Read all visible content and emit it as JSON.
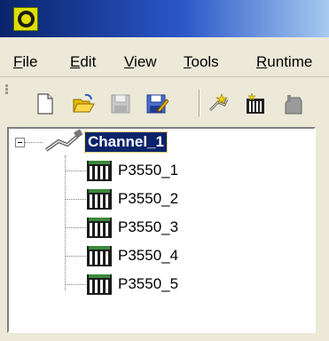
{
  "menubar": {
    "items": [
      {
        "accel": "F",
        "rest": "ile"
      },
      {
        "accel": "E",
        "rest": "dit"
      },
      {
        "accel": "V",
        "rest": "iew"
      },
      {
        "accel": "T",
        "rest": "ools"
      },
      {
        "accel": "R",
        "rest": "untime"
      }
    ]
  },
  "toolbar": {
    "buttons": [
      "new-document-icon",
      "open-folder-icon",
      "save-icon",
      "save-as-icon",
      "new-channel-icon",
      "new-device-icon",
      "properties-icon"
    ]
  },
  "tree": {
    "channel": {
      "label": "Channel_1",
      "expanded": true,
      "selected": true
    },
    "devices": [
      "P3550_1",
      "P3550_2",
      "P3550_3",
      "P3550_4",
      "P3550_5"
    ]
  },
  "colors": {
    "title_gradient_start": "#0a246a",
    "title_gradient_end": "#a6caf0",
    "selection": "#0a246a",
    "chrome": "#ece9d8"
  }
}
